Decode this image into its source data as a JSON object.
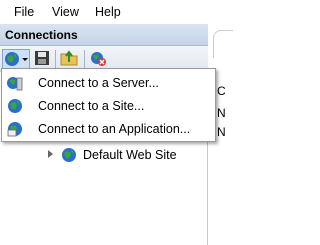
{
  "menu": {
    "file": "File",
    "view": "View",
    "help": "Help"
  },
  "connections": {
    "title": "Connections",
    "toolbar_icons": [
      "connect-dropdown-icon",
      "save-icon",
      "up-folder-icon",
      "disconnect-icon"
    ]
  },
  "dropdown": {
    "items": [
      {
        "label": "Connect to a Server...",
        "icon": "server-globe-icon"
      },
      {
        "label": "Connect to a Site...",
        "icon": "globe-icon"
      },
      {
        "label": "Connect to an Application...",
        "icon": "application-icon"
      }
    ]
  },
  "tree": {
    "site_label": "Default Web Site"
  },
  "right_pane": {
    "letters": [
      "C",
      "N",
      "N"
    ]
  },
  "colors": {
    "header_gradient_top": "#d9e4f1",
    "header_gradient_bottom": "#c3d3e6",
    "globe_blue": "#2a6fcf",
    "globe_green": "#3aa53a"
  }
}
